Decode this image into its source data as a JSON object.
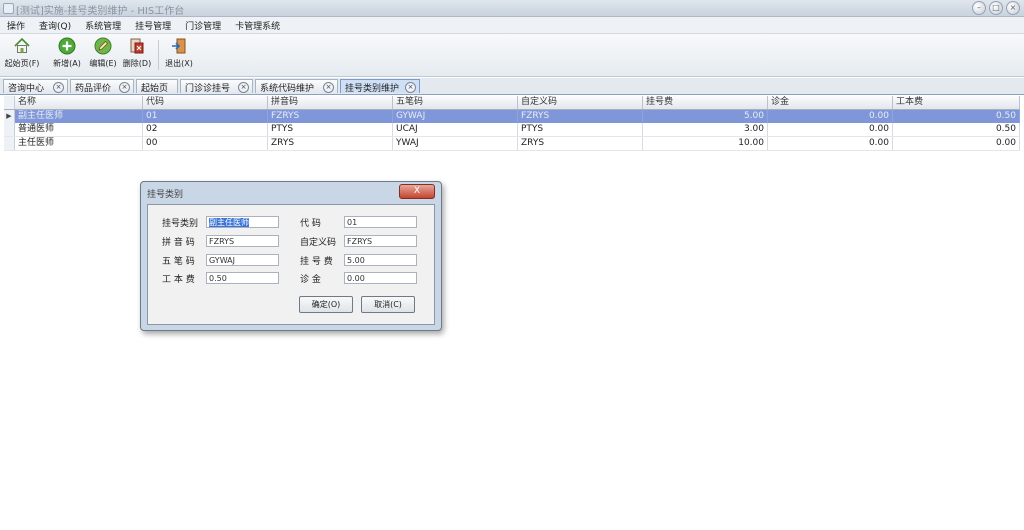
{
  "window": {
    "title": "[测试]实施-挂号类别维护 - HIS工作台"
  },
  "menu": {
    "items": [
      "操作",
      "查询(Q)",
      "系统管理",
      "挂号管理",
      "门诊管理",
      "卡管理系统"
    ]
  },
  "toolbar": {
    "home_label": "起始页(F)",
    "add_label": "新增(A)",
    "edit_label": "编辑(E)",
    "delete_label": "删除(D)",
    "exit_label": "退出(X)"
  },
  "tabs": [
    "咨询中心",
    "药品评价",
    "起始页",
    "门诊诊挂号",
    "系统代码维护",
    "挂号类别维护"
  ],
  "grid": {
    "columns": [
      "名称",
      "代码",
      "拼音码",
      "五笔码",
      "自定义码",
      "挂号费",
      "诊金",
      "工本费"
    ],
    "rows": [
      [
        "副主任医师",
        "01",
        "FZRYS",
        "GYWAJ",
        "FZRYS",
        "5.00",
        "0.00",
        "0.50"
      ],
      [
        "普通医师",
        "02",
        "PTYS",
        "UCAJ",
        "PTYS",
        "3.00",
        "0.00",
        "0.50"
      ],
      [
        "主任医师",
        "00",
        "ZRYS",
        "YWAJ",
        "ZRYS",
        "10.00",
        "0.00",
        "0.00"
      ]
    ]
  },
  "dialog": {
    "title": "挂号类别",
    "close_label": "X",
    "fields": {
      "category_label": "挂号类别",
      "category_value": "副主任医师",
      "code_label": "代    码",
      "code_value": "01",
      "pinyin_label": "拼 音 码",
      "pinyin_value": "FZRYS",
      "custom_label": "自定义码",
      "custom_value": "FZRYS",
      "wubi_label": "五 笔 码",
      "wubi_value": "GYWAJ",
      "fee_label": "挂 号 费",
      "fee_value": "5.00",
      "cost_label": "工 本 费",
      "cost_value": "0.50",
      "diag_label": "诊    金",
      "diag_value": "0.00"
    },
    "ok_label": "确定(O)",
    "cancel_label": "取消(C)"
  },
  "colors": {
    "selection": "#7f97d8",
    "active_tab": "#cfe0f6",
    "close_button": "#c4442f"
  }
}
